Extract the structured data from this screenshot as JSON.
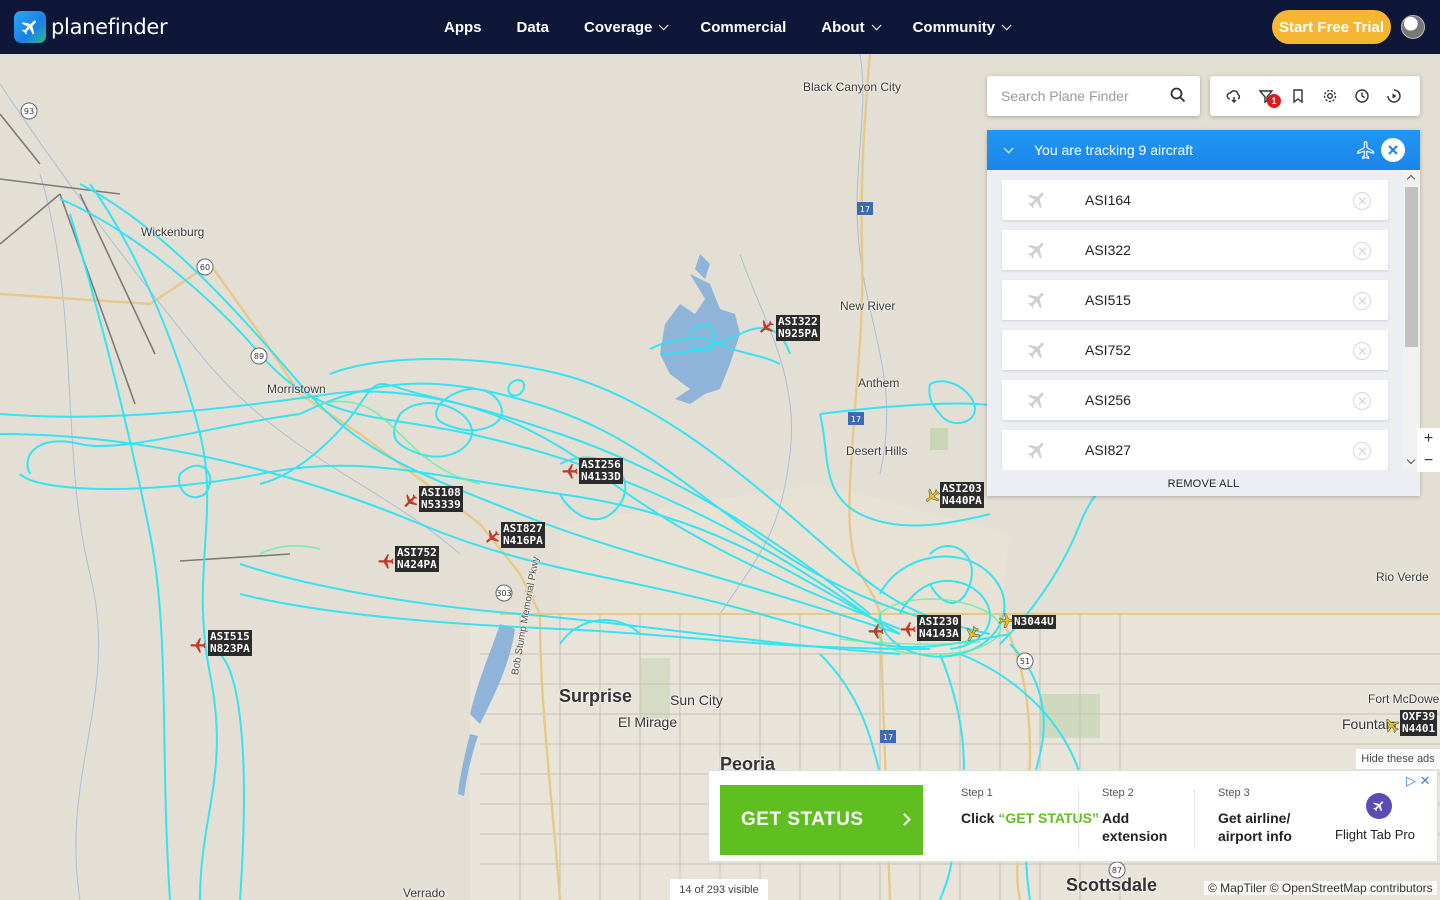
{
  "nav": {
    "brand": "planefinder",
    "links": [
      {
        "label": "Apps",
        "dropdown": false
      },
      {
        "label": "Data",
        "dropdown": false
      },
      {
        "label": "Coverage",
        "dropdown": true
      },
      {
        "label": "Commercial",
        "dropdown": false
      },
      {
        "label": "About",
        "dropdown": true
      },
      {
        "label": "Community",
        "dropdown": true
      }
    ],
    "trial_label": "Start Free Trial"
  },
  "search": {
    "placeholder": "Search Plane Finder"
  },
  "toolbar": {
    "icons": [
      "weather-icon",
      "filter-icon",
      "bookmark-icon",
      "settings-icon",
      "history-icon",
      "playback-icon"
    ],
    "filter_badge": "1"
  },
  "tracking": {
    "title": "You are tracking 9 aircraft",
    "aircraft": [
      "ASI164",
      "ASI322",
      "ASI515",
      "ASI752",
      "ASI256",
      "ASI827"
    ],
    "remove_all": "REMOVE ALL"
  },
  "map": {
    "places": [
      "Black Canyon City",
      "Wickenburg",
      "New River",
      "Anthem",
      "Morristown",
      "Desert Hills",
      "Rio Verde",
      "Surprise",
      "Sun City",
      "El Mirage",
      "Peoria",
      "Fort McDowell",
      "Fountain Hills",
      "Scottsdale",
      "Verrado",
      "Bob Stump Memorial Pkwy"
    ],
    "road_shields": [
      "93",
      "60",
      "89",
      "17",
      "17",
      "303",
      "51",
      "87",
      "17"
    ],
    "aircraft_labels": [
      {
        "cs": "ASI322",
        "reg": "N925PA"
      },
      {
        "cs": "ASI256",
        "reg": "N4133D"
      },
      {
        "cs": "ASI108",
        "reg": "N53339"
      },
      {
        "cs": "ASI827",
        "reg": "N416PA"
      },
      {
        "cs": "ASI752",
        "reg": "N424PA"
      },
      {
        "cs": "ASI515",
        "reg": "N823PA"
      },
      {
        "cs": "ASI203",
        "reg": "N440PA"
      },
      {
        "cs": "ASI230",
        "reg": "N4143A"
      },
      {
        "cs": "N3044U",
        "reg": ""
      },
      {
        "cs": "OXF39",
        "reg": "N4401"
      }
    ],
    "track_color": "#2ee3f4",
    "visible_count": "14 of 293 visible",
    "attribution": "© MapTiler © OpenStreetMap contributors",
    "zoom_in": "+",
    "zoom_out": "−"
  },
  "ad": {
    "hide_label": "Hide these ads",
    "button_label": "GET STATUS",
    "steps": [
      {
        "num": "Step 1",
        "text_pre": "Click ",
        "text_hl": "“GET STATUS”"
      },
      {
        "num": "Step 2",
        "text": "Add extension"
      },
      {
        "num": "Step 3",
        "text": "Get airline/ airport info"
      }
    ],
    "product": "Flight Tab Pro"
  },
  "colors": {
    "nav_bg": "#0f1738",
    "accent_blue": "#2196f3",
    "trial": "#f5b731",
    "ad_green": "#5fbf20"
  }
}
